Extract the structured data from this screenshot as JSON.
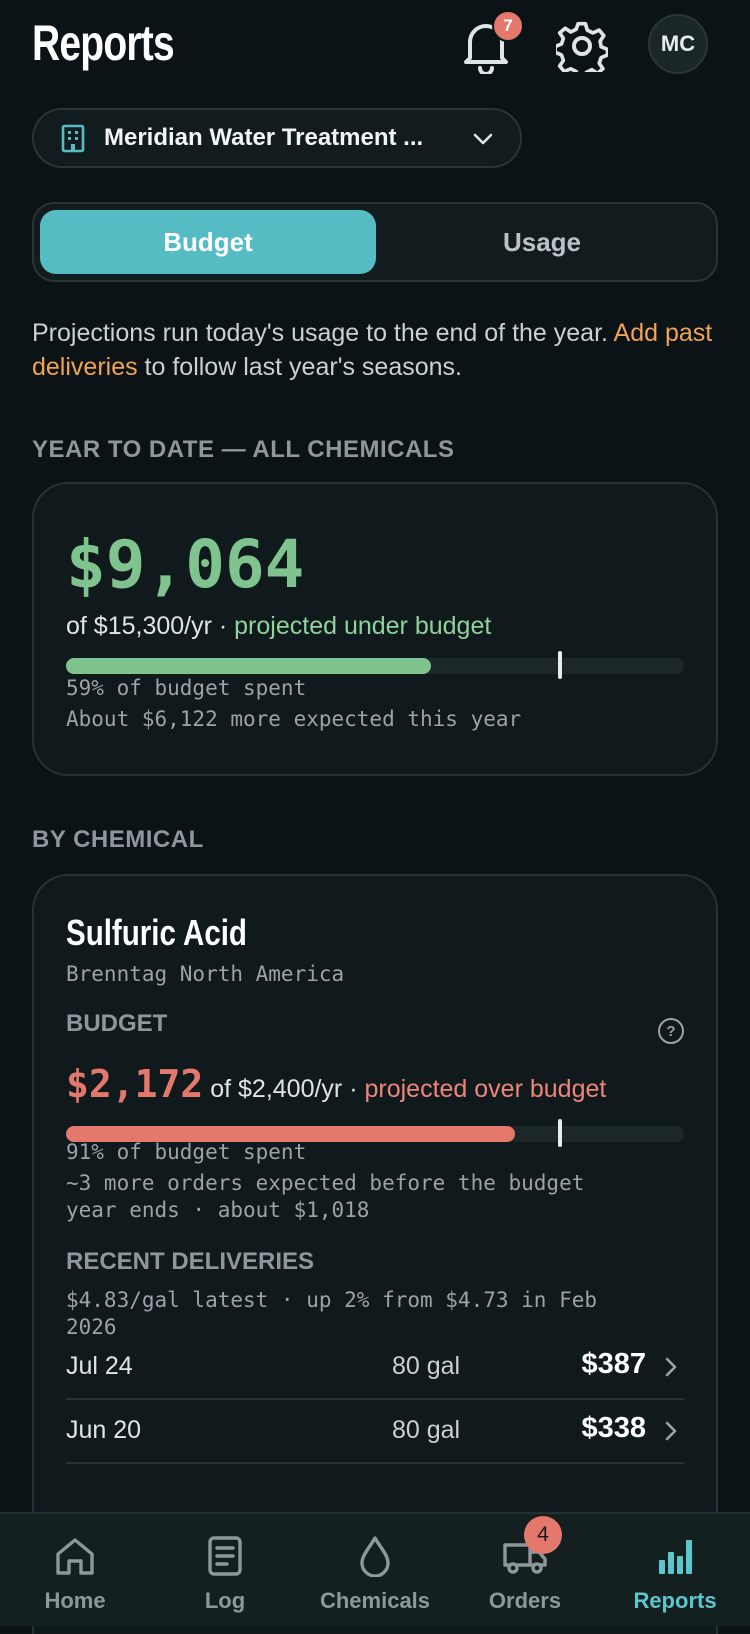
{
  "header": {
    "title": "Reports",
    "notification_count": "7",
    "avatar_initials": "MC"
  },
  "facility": {
    "name": "Meridian Water Treatment ..."
  },
  "tabs": {
    "budget": "Budget",
    "usage": "Usage",
    "active": "Budget"
  },
  "note": {
    "text_before": "Projections run today's usage to the end of the year. ",
    "link": "Add past deliveries",
    "text_after": " to follow last year's seasons."
  },
  "ytd": {
    "section_label": "YEAR TO DATE — ALL CHEMICALS",
    "amount": "$9,064",
    "budget_text": "of $15,300/yr · ",
    "status": "projected under budget",
    "spent_fraction": 0.59,
    "projected_fraction": 0.8,
    "pct_text": "59% of budget spent",
    "expected_text": "About $6,122 more expected this year",
    "colors": {
      "fill": "#7fc48e"
    }
  },
  "by_chemical": {
    "section_label": "BY CHEMICAL",
    "chemical": {
      "name": "Sulfuric Acid",
      "supplier": "Brenntag North America",
      "budget_label": "BUDGET",
      "help": "?",
      "amount": "$2,172",
      "budget_text": " of $2,400/yr · ",
      "status": "projected over budget",
      "spent_fraction": 0.726,
      "projected_fraction": 0.8,
      "pct_text": "91% of budget spent",
      "expected_line1": "~3 more orders expected before the budget",
      "expected_line2": "year ends · about $1,018",
      "recent_label": "RECENT DELIVERIES",
      "price_line1": "$4.83/gal latest · up 2% from $4.73 in Feb",
      "price_line2": "2026",
      "deliveries": [
        {
          "date": "Jul 24",
          "qty": "80 gal",
          "price": "$387"
        },
        {
          "date": "Jun 20",
          "qty": "80 gal",
          "price": "$338"
        }
      ],
      "colors": {
        "fill": "#e5786c"
      }
    }
  },
  "nav": {
    "items": [
      {
        "label": "Home",
        "icon": "home-icon"
      },
      {
        "label": "Log",
        "icon": "log-icon"
      },
      {
        "label": "Chemicals",
        "icon": "drop-icon"
      },
      {
        "label": "Orders",
        "icon": "truck-icon"
      },
      {
        "label": "Reports",
        "icon": "bar-chart-icon"
      }
    ],
    "active": "Reports",
    "orders_badge": "4"
  }
}
